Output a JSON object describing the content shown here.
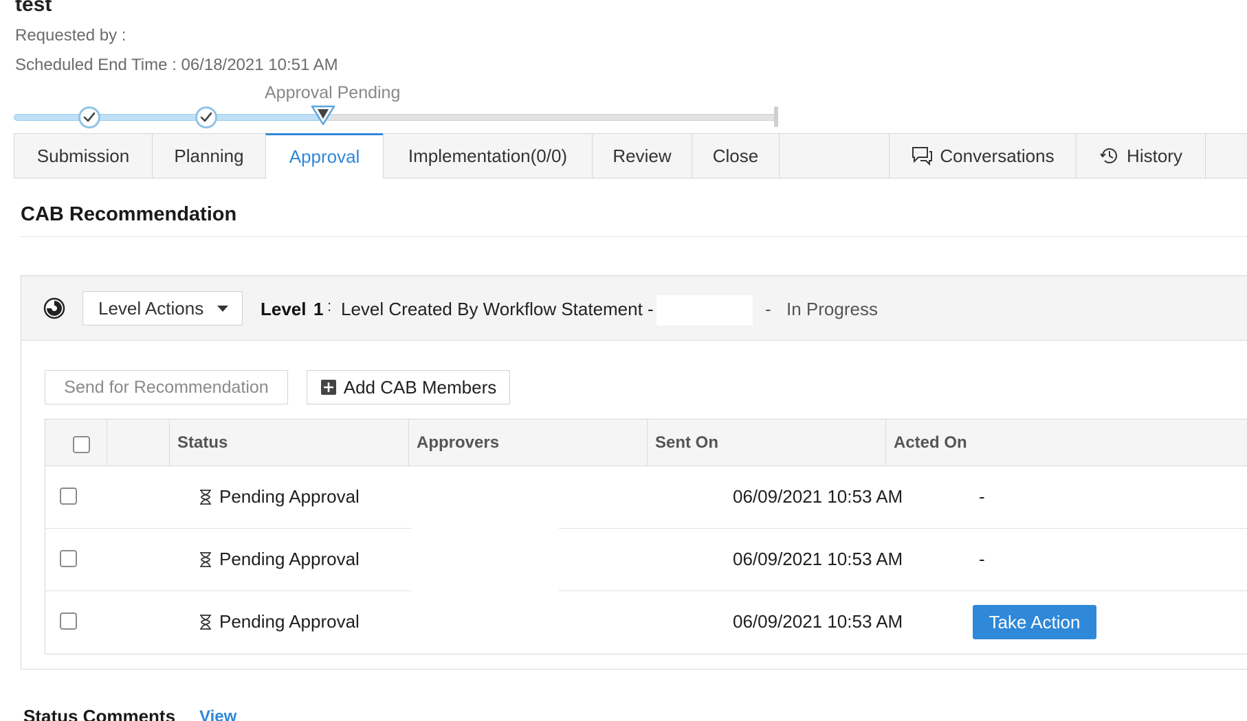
{
  "request": {
    "title": "test",
    "requested_by": "Requested by :",
    "scheduled_end": "Scheduled End Time : 06/18/2021 10:51 AM"
  },
  "progress": {
    "current_stage_caption": "Approval Pending"
  },
  "tabs": {
    "submission": "Submission",
    "planning": "Planning",
    "approval": "Approval",
    "implementation": "Implementation(0/0)",
    "review": "Review",
    "close": "Close",
    "conversations": "Conversations",
    "history": "History",
    "active": "Approval"
  },
  "cab": {
    "section_title": "CAB Recommendation",
    "level_actions_label": "Level Actions",
    "level_label": "Level",
    "level_number": "1",
    "level_colon": ":",
    "level_description": "Level Created By Workflow Statement -",
    "level_dash": "-",
    "level_status": "In Progress",
    "send_button": "Send for Recommendation",
    "add_members_button": "Add CAB Members",
    "columns": {
      "status": "Status",
      "approvers": "Approvers",
      "sent_on": "Sent On",
      "acted_on": "Acted On"
    },
    "rows": [
      {
        "status": "Pending Approval",
        "approvers": "",
        "sent_on": "06/09/2021 10:53 AM",
        "acted_on": "-"
      },
      {
        "status": "Pending Approval",
        "approvers": "",
        "sent_on": "06/09/2021 10:53 AM",
        "acted_on": "-"
      },
      {
        "status": "Pending Approval",
        "approvers": "",
        "sent_on": "06/09/2021 10:53 AM",
        "acted_on": "Take Action"
      }
    ]
  },
  "comments": {
    "title": "Status Comments",
    "view_link": "View"
  },
  "colors": {
    "accent": "#2f88d8",
    "progress_done": "#bfe0f7",
    "tab_bg": "#f5f5f5"
  },
  "icons": {
    "stage_done": "check-circle-icon",
    "stage_current": "down-triangle-icon",
    "level": "clock-half-icon",
    "status": "hourglass-icon",
    "conversations": "chat-bubble-icon",
    "history": "history-clock-icon",
    "add": "plus-square-icon"
  }
}
